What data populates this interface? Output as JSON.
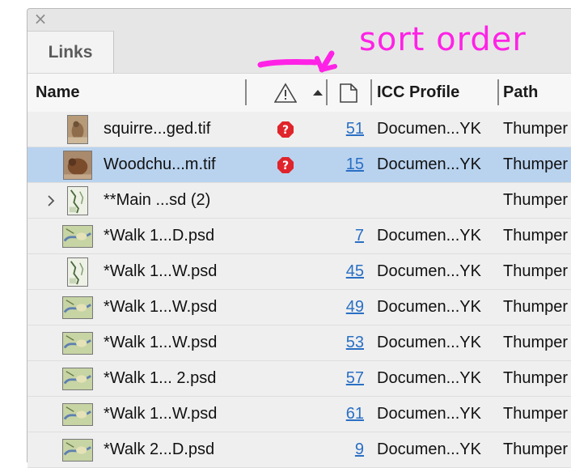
{
  "panel": {
    "close_glyph": "×",
    "tab_label": "Links"
  },
  "header": {
    "name": "Name",
    "icc": "ICC Profile",
    "path": "Path",
    "warning_icon": "warning-triangle-icon",
    "sort_icon": "sort-ascending-icon",
    "page_icon": "page-icon"
  },
  "annotation": {
    "text": "sort order",
    "color": "#ff22e6"
  },
  "rows": [
    {
      "name": "squirre...ged.tif",
      "warning": true,
      "page": "51",
      "icc": "Documen...YK",
      "path": "Thumper",
      "selected": false,
      "thumb": "photo-squirrel"
    },
    {
      "name": "Woodchu...m.tif",
      "warning": true,
      "page": "15",
      "icc": "Documen...YK",
      "path": "Thumper",
      "selected": true,
      "thumb": "photo-woodchuck"
    },
    {
      "name": "**Main ...sd (2)",
      "warning": false,
      "page": "",
      "icc": "",
      "path": "Thumper",
      "selected": false,
      "thumb": "map-portrait",
      "expandable": true
    },
    {
      "name": "*Walk 1...D.psd",
      "warning": false,
      "page": "7",
      "icc": "Documen...YK",
      "path": "Thumper",
      "selected": false,
      "thumb": "map-landscape"
    },
    {
      "name": "*Walk 1...W.psd",
      "warning": false,
      "page": "45",
      "icc": "Documen...YK",
      "path": "Thumper",
      "selected": false,
      "thumb": "map-portrait"
    },
    {
      "name": "*Walk 1...W.psd",
      "warning": false,
      "page": "49",
      "icc": "Documen...YK",
      "path": "Thumper",
      "selected": false,
      "thumb": "map-landscape"
    },
    {
      "name": "*Walk 1...W.psd",
      "warning": false,
      "page": "53",
      "icc": "Documen...YK",
      "path": "Thumper",
      "selected": false,
      "thumb": "map-landscape"
    },
    {
      "name": "*Walk 1... 2.psd",
      "warning": false,
      "page": "57",
      "icc": "Documen...YK",
      "path": "Thumper",
      "selected": false,
      "thumb": "map-landscape"
    },
    {
      "name": "*Walk 1...W.psd",
      "warning": false,
      "page": "61",
      "icc": "Documen...YK",
      "path": "Thumper",
      "selected": false,
      "thumb": "map-landscape"
    },
    {
      "name": "*Walk 2...D.psd",
      "warning": false,
      "page": "9",
      "icc": "Documen...YK",
      "path": "Thumper",
      "selected": false,
      "thumb": "map-landscape"
    }
  ]
}
